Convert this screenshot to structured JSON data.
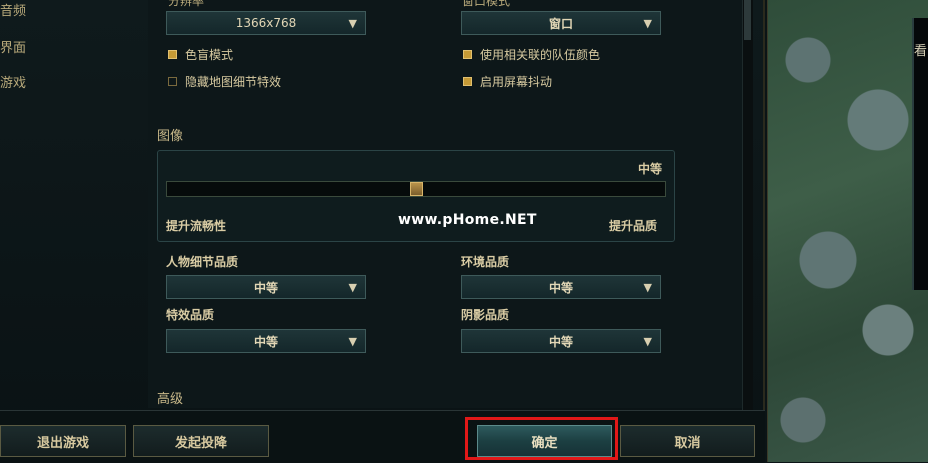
{
  "nav": {
    "items": [
      "音频",
      "界面",
      "游戏"
    ]
  },
  "video": {
    "resolution_label_partial": "分辨率",
    "resolution_value": "1366x768",
    "window_mode_label_partial": "窗口模式",
    "window_mode_value": "窗口",
    "colorblind_mode": {
      "label": "色盲模式",
      "checked": true
    },
    "hide_eye_candy": {
      "label": "隐藏地图细节特效",
      "checked": false
    },
    "relative_team_colors": {
      "label": "使用相关联的队伍颜色",
      "checked": true
    },
    "screen_shake": {
      "label": "启用屏幕抖动",
      "checked": true
    }
  },
  "graphics": {
    "title": "图像",
    "level": "中等",
    "slider_fraction": 0.5,
    "left_hint": "提升流畅性",
    "right_hint": "提升品质"
  },
  "quality": {
    "character": {
      "label": "人物细节品质",
      "value": "中等"
    },
    "environment": {
      "label": "环境品质",
      "value": "中等"
    },
    "effects": {
      "label": "特效品质",
      "value": "中等"
    },
    "shadows": {
      "label": "阴影品质",
      "value": "中等"
    }
  },
  "next_section_partial": "高级",
  "buttons": {
    "exit": "退出游戏",
    "surrender": "发起投降",
    "confirm": "确定",
    "cancel": "取消"
  },
  "watermark": "www.pHome.NET",
  "map_overlay_char": "看",
  "colors": {
    "accent_teal": "#2e5a5d",
    "highlight_red": "#e01818",
    "checkbox_on": "#c59a36"
  }
}
